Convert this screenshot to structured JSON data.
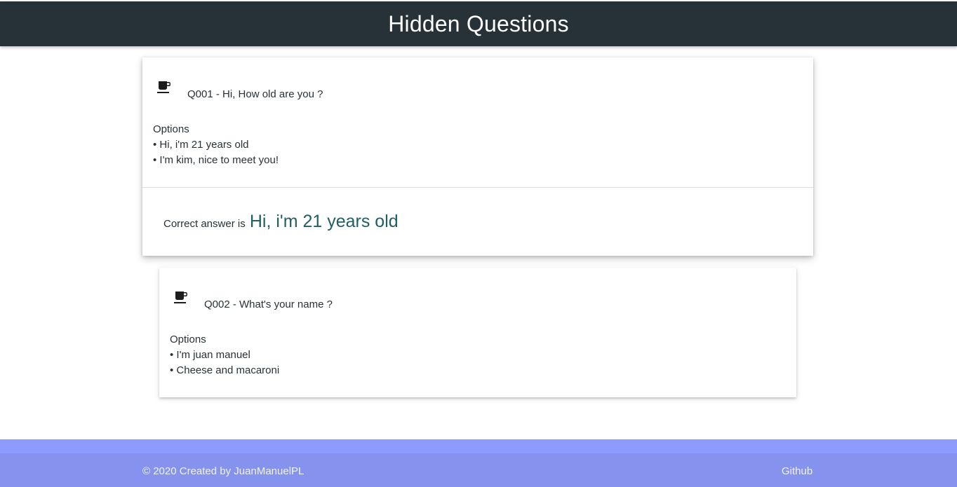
{
  "header": {
    "title": "Hidden Questions"
  },
  "questions": [
    {
      "icon": "coffee-cup-icon",
      "title": "Q001 - Hi, How old are you ?",
      "options_label": "Options",
      "options": [
        "• Hi, i'm 21 years old",
        "• I'm kim, nice to meet you!"
      ],
      "answer_prefix": "Correct answer is",
      "answer": "Hi, i'm 21 years old"
    },
    {
      "icon": "coffee-cup-icon",
      "title": "Q002 - What's your name ?",
      "options_label": "Options",
      "options": [
        "• I'm juan manuel",
        "• Cheese and macaroni"
      ]
    }
  ],
  "footer": {
    "copyright": "© 2020 Created by JuanManuelPL",
    "github_label": "Github"
  },
  "colors": {
    "header_bg": "#263238",
    "answer_accent": "#215f62",
    "footer_bg": "#8592ee"
  }
}
